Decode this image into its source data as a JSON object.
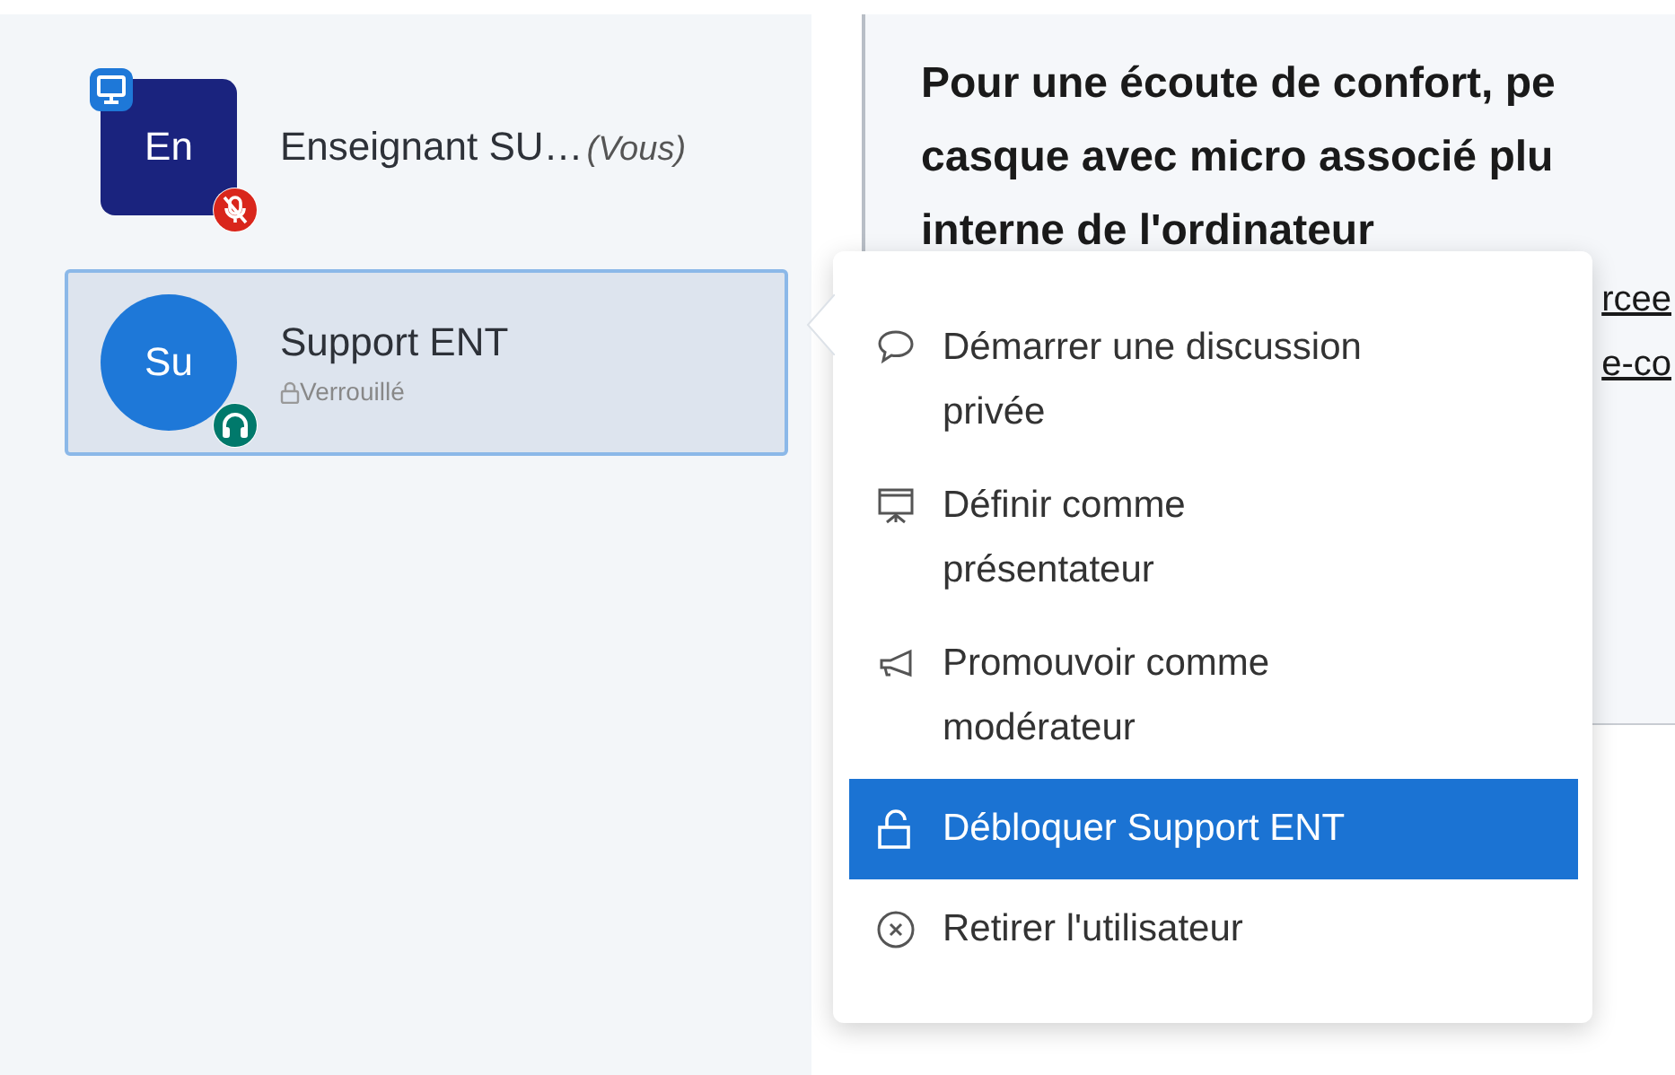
{
  "users": [
    {
      "initials": "En",
      "name": "Enseignant SU…",
      "you_label": "(Vous)",
      "moderator": true,
      "color": "#1a237e",
      "presenter": true,
      "muted": true,
      "listen_only": false,
      "selected": false
    },
    {
      "initials": "Su",
      "name": "Support ENT",
      "status": "Verrouillé",
      "locked": true,
      "moderator": false,
      "color": "#1e78d8",
      "presenter": false,
      "muted": false,
      "listen_only": true,
      "selected": true
    }
  ],
  "chat": {
    "lines": [
      "Pour une écoute de confort, pe",
      "casque avec micro associé plu",
      "interne de l'ordinateur"
    ],
    "links": [
      "rcee",
      "e-co"
    ]
  },
  "menu": {
    "items": [
      {
        "kind": "chat",
        "label": "Démarrer une discussion privée",
        "selected": false
      },
      {
        "kind": "presenter",
        "label": "Définir comme présentateur",
        "selected": false
      },
      {
        "kind": "promote",
        "label": "Promouvoir comme modérateur",
        "selected": false
      },
      {
        "kind": "unlock",
        "label": "Débloquer Support ENT",
        "selected": true
      },
      {
        "kind": "remove",
        "label": "Retirer l'utilisateur",
        "selected": false
      }
    ]
  }
}
